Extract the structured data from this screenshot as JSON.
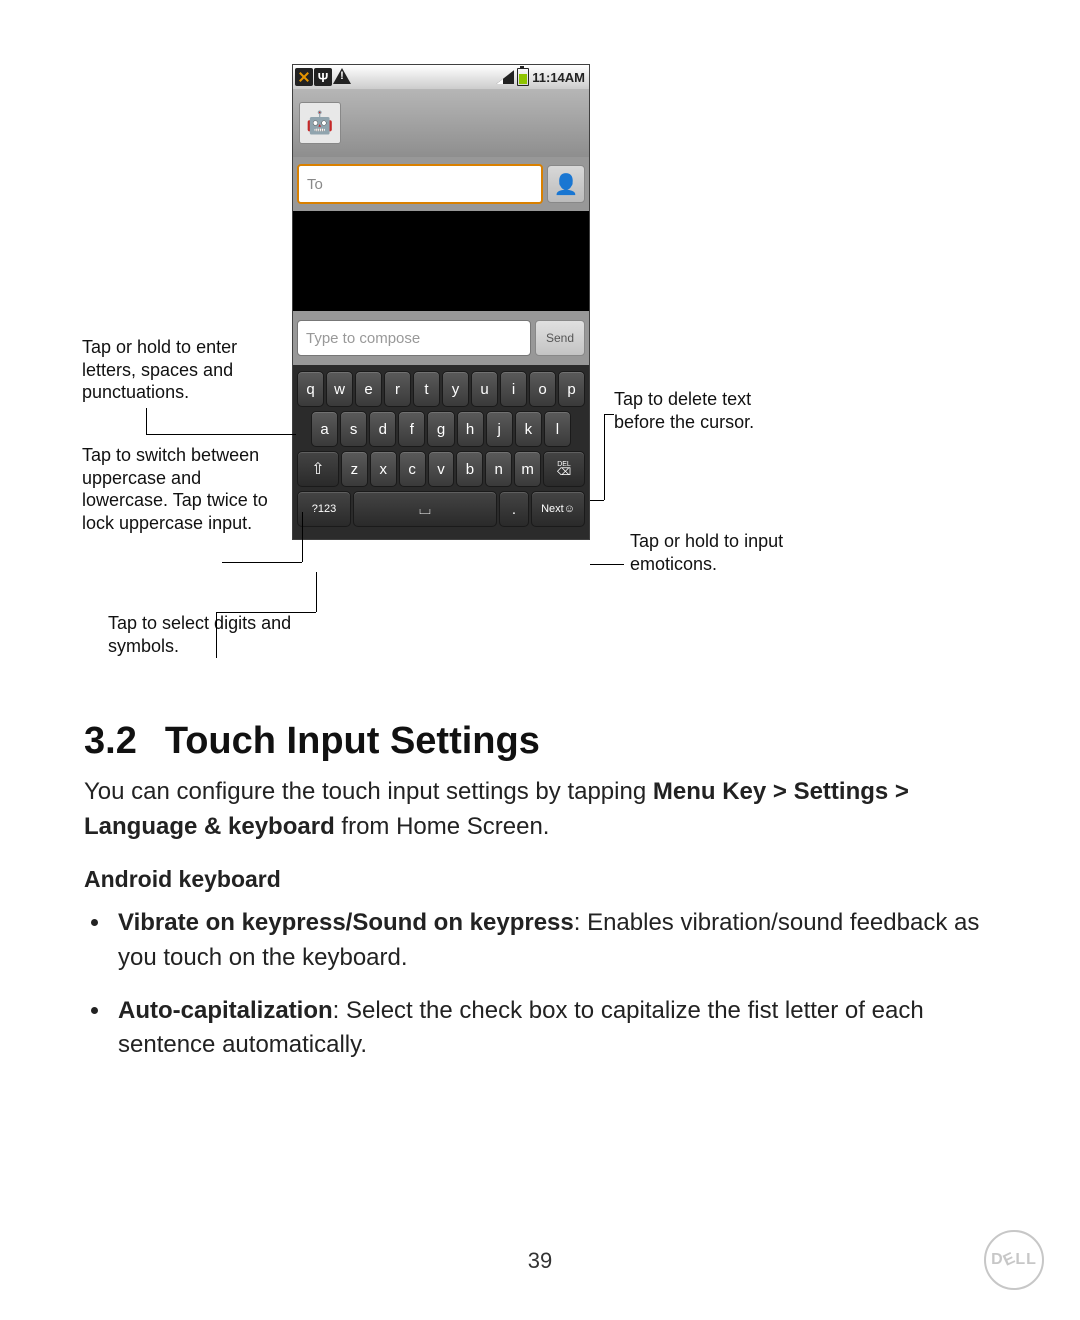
{
  "statusbar": {
    "time": "11:14AM"
  },
  "avatar_glyph": "🤖",
  "to_input": {
    "placeholder": "To"
  },
  "contact_glyph": "👤",
  "compose_input": {
    "placeholder": "Type to compose"
  },
  "send_label": "Send",
  "keyboard": {
    "row1": [
      "q",
      "w",
      "e",
      "r",
      "t",
      "y",
      "u",
      "i",
      "o",
      "p"
    ],
    "row2": [
      "a",
      "s",
      "d",
      "f",
      "g",
      "h",
      "j",
      "k",
      "l"
    ],
    "row3": [
      "z",
      "x",
      "c",
      "v",
      "b",
      "n",
      "m"
    ],
    "shift_glyph": "⇧",
    "del_top": "DEL",
    "del_glyph": "⌫",
    "sym_label": "?123",
    "space_glyph": "⌴",
    "dot_label": ".",
    "next_label": "Next"
  },
  "callouts": {
    "letters": "Tap or hold to enter letters, spaces and punctuations.",
    "shift": "Tap to switch between uppercase and lowercase. Tap twice to lock uppercase input.",
    "symbols": "Tap to select digits and symbols.",
    "del": "Tap to delete text before the cursor.",
    "emoticons": "Tap or hold to input emoticons."
  },
  "section": {
    "number": "3.2",
    "title": "Touch Input Settings",
    "intro_pre": "You can configure the touch input settings by tapping ",
    "intro_bold": "Menu Key > Settings > Language & keyboard",
    "intro_post": " from Home Screen.",
    "subhead": "Android keyboard",
    "bullets": [
      {
        "bold": "Vibrate on keypress/Sound on keypress",
        "rest": ": Enables vibration/sound feedback as you touch on the keyboard."
      },
      {
        "bold": "Auto-capitalization",
        "rest": ": Select the check box to capitalize the fist letter of each sentence automatically."
      }
    ]
  },
  "page_number": "39",
  "brand": {
    "d": "D",
    "e": "E",
    "ll": "LL"
  }
}
